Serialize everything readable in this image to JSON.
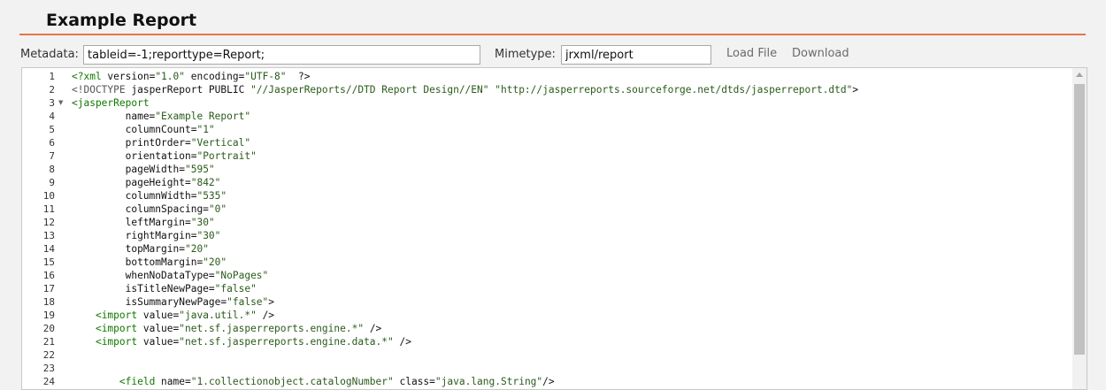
{
  "header": {
    "title": "Example Report"
  },
  "form": {
    "metadata_label": "Metadata:",
    "metadata_value": "tableid=-1;reporttype=Report;",
    "mimetype_label": "Mimetype:",
    "mimetype_value": "jrxml/report",
    "load_file_label": "Load File",
    "download_label": "Download"
  },
  "editor": {
    "lines": [
      {
        "num": "1",
        "fold": "",
        "text": "<?xml version=\"1.0\" encoding=\"UTF-8\"  ?>"
      },
      {
        "num": "2",
        "fold": "",
        "text": "<!DOCTYPE jasperReport PUBLIC \"//JasperReports//DTD Report Design//EN\" \"http://jasperreports.sourceforge.net/dtds/jasperreport.dtd\">"
      },
      {
        "num": "3",
        "fold": "▼",
        "text": "<jasperReport"
      },
      {
        "num": "4",
        "fold": "",
        "text": "         name=\"Example Report\""
      },
      {
        "num": "5",
        "fold": "",
        "text": "         columnCount=\"1\""
      },
      {
        "num": "6",
        "fold": "",
        "text": "         printOrder=\"Vertical\""
      },
      {
        "num": "7",
        "fold": "",
        "text": "         orientation=\"Portrait\""
      },
      {
        "num": "8",
        "fold": "",
        "text": "         pageWidth=\"595\""
      },
      {
        "num": "9",
        "fold": "",
        "text": "         pageHeight=\"842\""
      },
      {
        "num": "10",
        "fold": "",
        "text": "         columnWidth=\"535\""
      },
      {
        "num": "11",
        "fold": "",
        "text": "         columnSpacing=\"0\""
      },
      {
        "num": "12",
        "fold": "",
        "text": "         leftMargin=\"30\""
      },
      {
        "num": "13",
        "fold": "",
        "text": "         rightMargin=\"30\""
      },
      {
        "num": "14",
        "fold": "",
        "text": "         topMargin=\"20\""
      },
      {
        "num": "15",
        "fold": "",
        "text": "         bottomMargin=\"20\""
      },
      {
        "num": "16",
        "fold": "",
        "text": "         whenNoDataType=\"NoPages\""
      },
      {
        "num": "17",
        "fold": "",
        "text": "         isTitleNewPage=\"false\""
      },
      {
        "num": "18",
        "fold": "",
        "text": "         isSummaryNewPage=\"false\">"
      },
      {
        "num": "19",
        "fold": "",
        "text": "    <import value=\"java.util.*\" />"
      },
      {
        "num": "20",
        "fold": "",
        "text": "    <import value=\"net.sf.jasperreports.engine.*\" />"
      },
      {
        "num": "21",
        "fold": "",
        "text": "    <import value=\"net.sf.jasperreports.engine.data.*\" />"
      },
      {
        "num": "22",
        "fold": "",
        "text": ""
      },
      {
        "num": "23",
        "fold": "",
        "text": ""
      },
      {
        "num": "24",
        "fold": "",
        "text": "        <field name=\"1.collectionobject.catalogNumber\" class=\"java.lang.String\"/>"
      }
    ]
  }
}
